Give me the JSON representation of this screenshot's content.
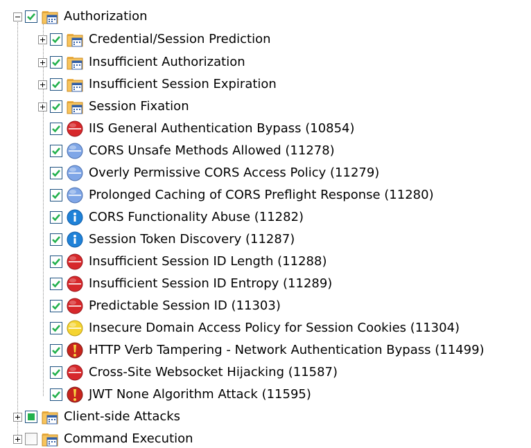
{
  "tree": {
    "root": {
      "label": "Authorization",
      "icon": "calendar-folder-icon",
      "expanded": true
    },
    "groups": [
      {
        "label": "Credential/Session Prediction",
        "icon": "calendar-folder-icon"
      },
      {
        "label": "Insufficient Authorization",
        "icon": "calendar-folder-icon"
      },
      {
        "label": "Insufficient Session Expiration",
        "icon": "calendar-folder-icon"
      },
      {
        "label": "Session Fixation",
        "icon": "calendar-folder-icon"
      }
    ],
    "checks": [
      {
        "label": "IIS General Authentication Bypass (10854)",
        "icon": "red-severity-icon",
        "color": "#d7282b"
      },
      {
        "label": "CORS Unsafe Methods Allowed  (11278)",
        "icon": "blue-severity-icon",
        "color": "#7fa6e7"
      },
      {
        "label": "Overly Permissive CORS Access Policy (11279)",
        "icon": "blue-severity-icon",
        "color": "#7fa6e7"
      },
      {
        "label": "Prolonged Caching of CORS Preflight Response (11280)",
        "icon": "blue-severity-icon",
        "color": "#7fa6e7"
      },
      {
        "label": "CORS Functionality Abuse (11282)",
        "icon": "info-icon",
        "color": "#1f82d8"
      },
      {
        "label": "Session Token Discovery (11287)",
        "icon": "info-icon",
        "color": "#1f82d8"
      },
      {
        "label": "Insufficient Session ID Length (11288)",
        "icon": "red-severity-icon",
        "color": "#d7282b"
      },
      {
        "label": "Insufficient Session ID Entropy (11289)",
        "icon": "red-severity-icon",
        "color": "#d7282b"
      },
      {
        "label": "Predictable Session ID (11303)",
        "icon": "red-severity-icon",
        "color": "#d7282b"
      },
      {
        "label": "Insecure Domain Access Policy for Session Cookies (11304)",
        "icon": "yellow-severity-icon",
        "color": "#f5d431"
      },
      {
        "label": "HTTP Verb Tampering - Network Authentication Bypass (11499)",
        "icon": "critical-warning-icon",
        "color": "#c8251d"
      },
      {
        "label": "Cross-Site Websocket Hijacking (11587)",
        "icon": "red-severity-icon",
        "color": "#d7282b"
      },
      {
        "label": "JWT None Algorithm Attack (11595)",
        "icon": "critical-warning-icon",
        "color": "#c8251d"
      }
    ],
    "siblings": [
      {
        "label": "Client-side Attacks",
        "icon": "calendar-folder-icon",
        "check_state": "partial"
      },
      {
        "label": "Command Execution",
        "icon": "calendar-folder-icon",
        "check_state": "unchecked"
      }
    ]
  },
  "colors": {
    "check_green": "#23b14d",
    "checkbox_border": "#1c5180",
    "tree_lines": "#8c8c8c"
  }
}
